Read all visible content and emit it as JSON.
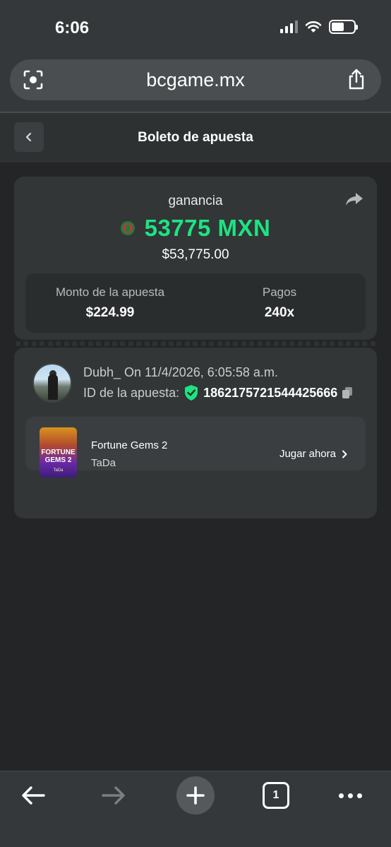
{
  "status_bar": {
    "time": "6:06"
  },
  "browser": {
    "url": "bcgame.mx",
    "tab_count": "1"
  },
  "header": {
    "title": "Boleto de apuesta"
  },
  "ticket": {
    "gain_label": "ganancia",
    "amount": "53775 MXN",
    "amount_usd": "$53,775.00",
    "bet_label": "Monto de la apuesta",
    "bet_value": "$224.99",
    "payout_label": "Pagos",
    "payout_value": "240x",
    "accent_color": "#1ee382"
  },
  "bet_info": {
    "user_line": "Dubh_  On 11/4/2026, 6:05:58 a.m.",
    "id_label": "ID de la apuesta:",
    "id_value": "1862175721544425666"
  },
  "game": {
    "thumb_title": "FORTUNE GEMS 2",
    "thumb_brand": "TaDa",
    "name": "Fortune Gems 2",
    "provider": "TaDa",
    "play_label": "Jugar ahora"
  },
  "icons": {
    "lens": "visual-search-icon",
    "share": "share-icon",
    "back": "chevron-left-icon",
    "forward_share": "forward-arrow-icon",
    "verified": "shield-check-icon",
    "copy": "copy-icon",
    "play_chevron": "chevron-right-icon"
  }
}
